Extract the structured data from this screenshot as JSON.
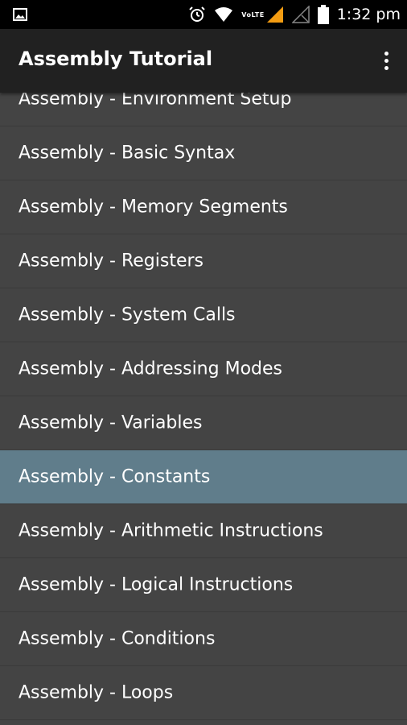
{
  "status_bar": {
    "left_icon": "image-icon",
    "icons": [
      "alarm-icon",
      "wifi-icon",
      "volte-signal-icon",
      "no-signal-icon",
      "battery-icon"
    ],
    "volte_label": "VoLTE",
    "time": "1:32 pm"
  },
  "app_bar": {
    "title": "Assembly Tutorial",
    "overflow_icon": "more-vert-icon"
  },
  "list": {
    "items": [
      {
        "label": "Assembly - Environment Setup"
      },
      {
        "label": "Assembly - Basic Syntax"
      },
      {
        "label": "Assembly - Memory Segments"
      },
      {
        "label": "Assembly - Registers"
      },
      {
        "label": "Assembly - System Calls"
      },
      {
        "label": "Assembly - Addressing Modes"
      },
      {
        "label": "Assembly - Variables"
      },
      {
        "label": "Assembly - Constants",
        "selected": true
      },
      {
        "label": "Assembly - Arithmetic Instructions"
      },
      {
        "label": "Assembly - Logical Instructions"
      },
      {
        "label": "Assembly - Conditions"
      },
      {
        "label": "Assembly - Loops"
      }
    ]
  },
  "colors": {
    "background": "#444444",
    "app_bar": "#212121",
    "status_bar": "#000000",
    "selected_row": "#607d8b",
    "signal_accent": "#f39c12",
    "text": "#ffffff"
  }
}
